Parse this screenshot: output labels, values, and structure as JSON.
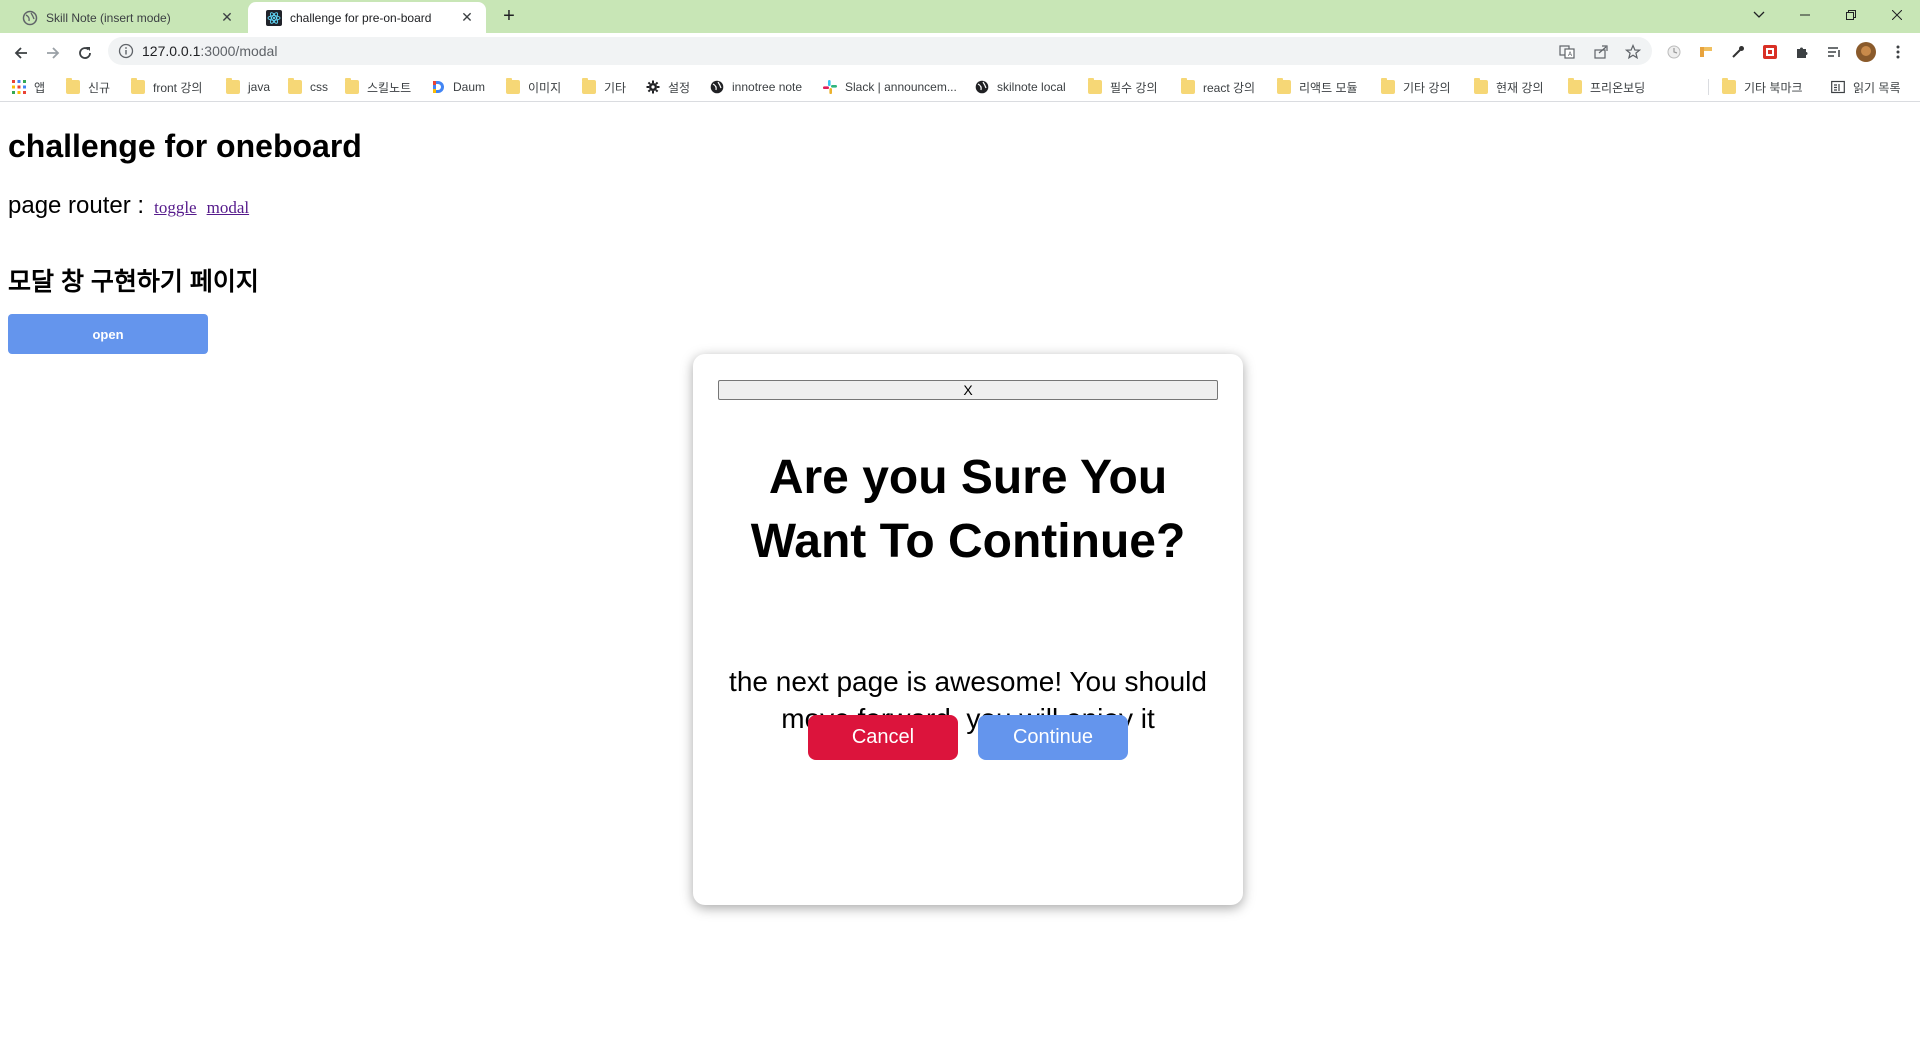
{
  "browser": {
    "tabs": [
      {
        "title": "Skill Note (insert mode)",
        "active": false
      },
      {
        "title": "challenge for pre-on-board",
        "active": true
      }
    ],
    "url_host": "127.0.0.1",
    "url_rest": ":3000/modal",
    "bookmarks": [
      {
        "label": "앱",
        "icon": "apps-grid-icon"
      },
      {
        "label": "신규",
        "icon": "folder-icon"
      },
      {
        "label": "front 강의",
        "icon": "folder-icon"
      },
      {
        "label": "java",
        "icon": "folder-icon"
      },
      {
        "label": "css",
        "icon": "folder-icon"
      },
      {
        "label": "스킬노트",
        "icon": "folder-icon"
      },
      {
        "label": "Daum",
        "icon": "daum-icon"
      },
      {
        "label": "이미지",
        "icon": "folder-icon"
      },
      {
        "label": "기타",
        "icon": "folder-icon"
      },
      {
        "label": "설정",
        "icon": "gear-icon"
      },
      {
        "label": "innotree note",
        "icon": "globe-icon"
      },
      {
        "label": "Slack | announcem...",
        "icon": "slack-icon"
      },
      {
        "label": "skilnote local",
        "icon": "globe-icon"
      },
      {
        "label": "필수 강의",
        "icon": "folder-icon"
      },
      {
        "label": "react 강의",
        "icon": "folder-icon"
      },
      {
        "label": "리액트 모듈",
        "icon": "folder-icon"
      },
      {
        "label": "기타 강의",
        "icon": "folder-icon"
      },
      {
        "label": "현재 강의",
        "icon": "folder-icon"
      },
      {
        "label": "프리온보딩",
        "icon": "folder-icon"
      },
      {
        "label": "기타 북마크",
        "icon": "folder-icon"
      },
      {
        "label": "읽기 목록",
        "icon": "reading-list-icon"
      }
    ]
  },
  "page": {
    "heading": "challenge for oneboard",
    "router_label": "page router :",
    "router_links": [
      "toggle",
      "modal"
    ],
    "subheading": "모달 창 구현하기 페이지",
    "open_button": "open"
  },
  "modal": {
    "close_label": "X",
    "title": "Are you Sure You Want To Continue?",
    "body": "the next page is awesome! You should move forward, you will enjoy it",
    "cancel_label": "Cancel",
    "continue_label": "Continue",
    "cancel_color": "#dc143c",
    "continue_color": "#6495ed"
  }
}
